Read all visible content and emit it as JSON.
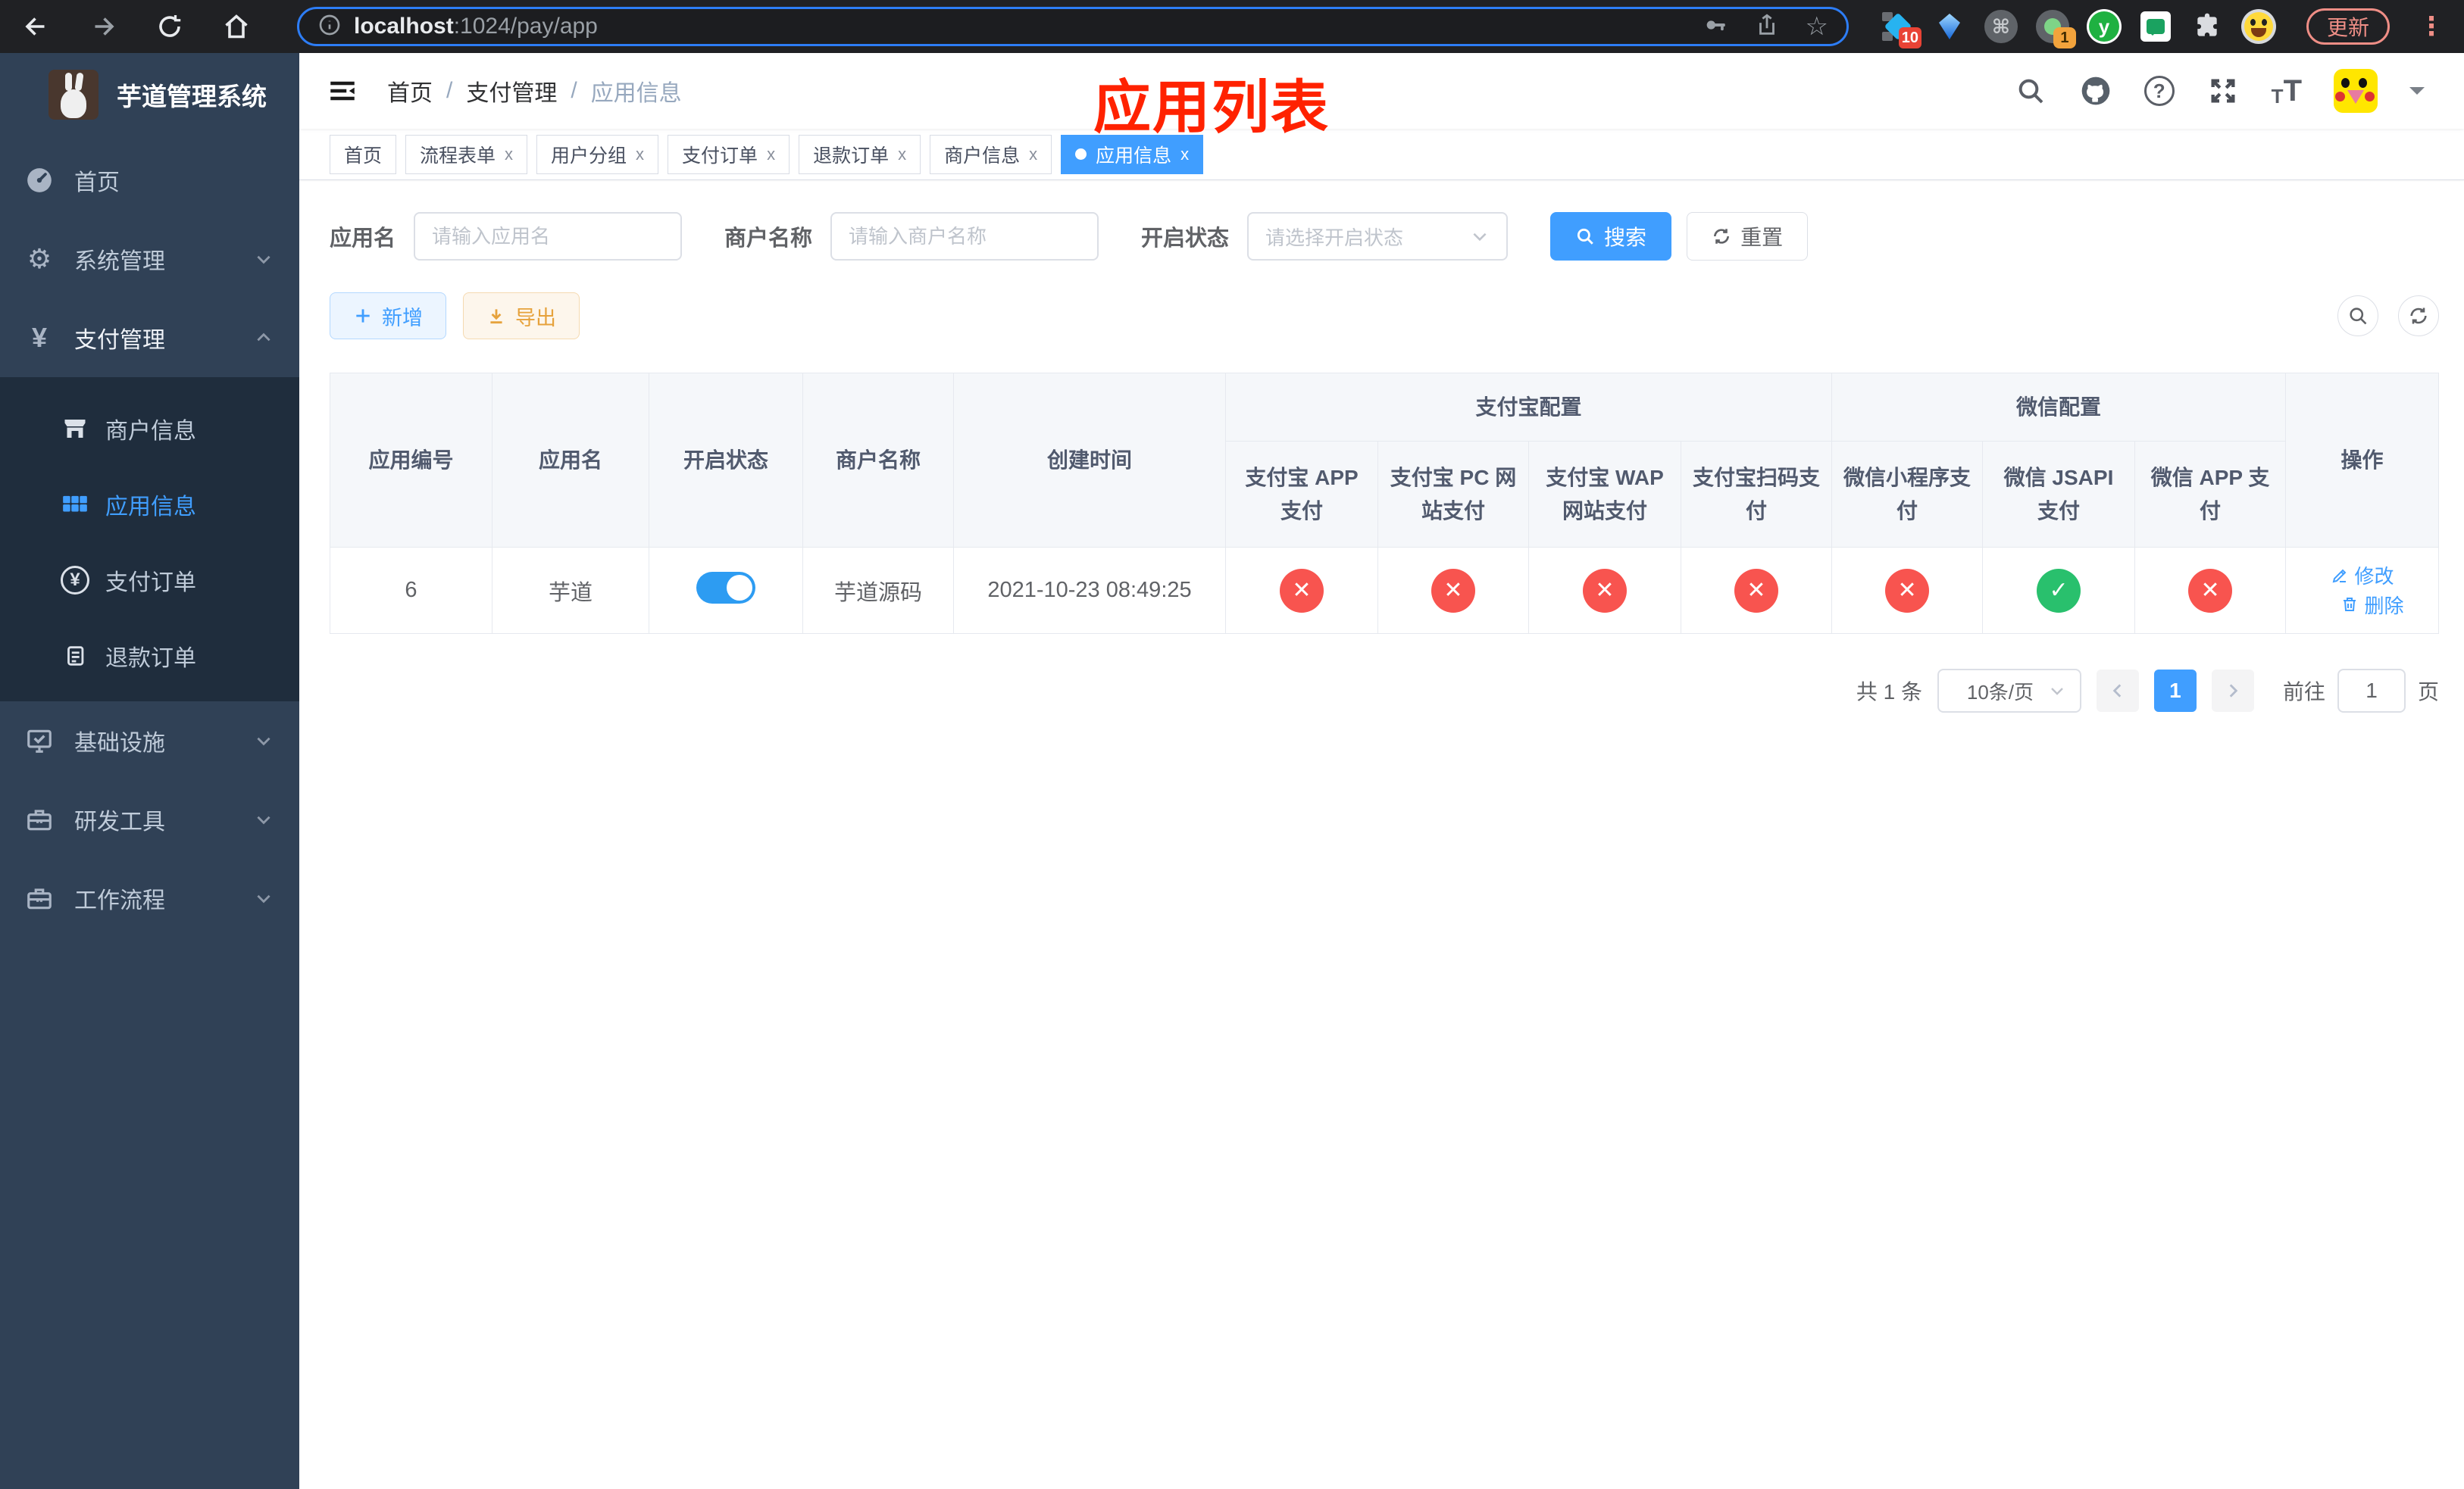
{
  "browser": {
    "url_host": "localhost",
    "url_rest": ":1024/pay/app",
    "update_label": "更新",
    "ext_badge_blue_diamond": "10",
    "ext_badge_gray_circle": "1",
    "ext_y_label": "y"
  },
  "glyphs": {
    "star": "☆",
    "command": "⌘",
    "dots": "⋮",
    "gear": "⚙",
    "yen": "¥",
    "question": "?",
    "t_small": "T",
    "t_big": "T"
  },
  "sidebar": {
    "title": "芋道管理系统",
    "items": [
      {
        "label": "首页"
      },
      {
        "label": "系统管理"
      },
      {
        "label": "支付管理"
      },
      {
        "label": "商户信息"
      },
      {
        "label": "应用信息"
      },
      {
        "label": "支付订单"
      },
      {
        "label": "退款订单"
      },
      {
        "label": "基础设施"
      },
      {
        "label": "研发工具"
      },
      {
        "label": "工作流程"
      }
    ]
  },
  "navbar": {
    "breadcrumb": [
      "首页",
      "支付管理",
      "应用信息"
    ],
    "separator": "/",
    "annotation": "应用列表"
  },
  "tabs": [
    {
      "label": "首页"
    },
    {
      "label": "流程表单",
      "close": "x"
    },
    {
      "label": "用户分组",
      "close": "x"
    },
    {
      "label": "支付订单",
      "close": "x"
    },
    {
      "label": "退款订单",
      "close": "x"
    },
    {
      "label": "商户信息",
      "close": "x"
    },
    {
      "label": "应用信息",
      "close": "x",
      "state": "active"
    }
  ],
  "filters": {
    "app_name_label": "应用名",
    "app_name_placeholder": "请输入应用名",
    "merchant_label": "商户名称",
    "merchant_placeholder": "请输入商户名称",
    "status_label": "开启状态",
    "status_placeholder": "请选择开启状态",
    "search_label": "搜索",
    "reset_label": "重置"
  },
  "toolbar": {
    "add_label": "新增",
    "export_label": "导出"
  },
  "table": {
    "col_id": "应用编号",
    "col_name": "应用名",
    "col_status": "开启状态",
    "col_merchant": "商户名称",
    "col_created": "创建时间",
    "group_alipay": "支付宝配置",
    "group_wechat": "微信配置",
    "sub": [
      "支付宝 APP 支付",
      "支付宝 PC 网站支付",
      "支付宝 WAP 网站支付",
      "支付宝扫码支付",
      "微信小程序支付",
      "微信 JSAPI 支付",
      "微信 APP 支付"
    ],
    "col_actions": "操作",
    "row": {
      "id": "6",
      "name": "芋道",
      "switch": "on",
      "merchant": "芋道源码",
      "created": "2021-10-23 08:49:25",
      "statuses": [
        "fail",
        "fail",
        "fail",
        "fail",
        "fail",
        "success",
        "fail"
      ],
      "edit_label": "修改",
      "delete_label": "删除"
    }
  },
  "pagination": {
    "total": "共 1 条",
    "page_size": "10条/页",
    "page": "1",
    "goto_label": "前往",
    "goto_value": "1",
    "page_suffix": "页"
  }
}
